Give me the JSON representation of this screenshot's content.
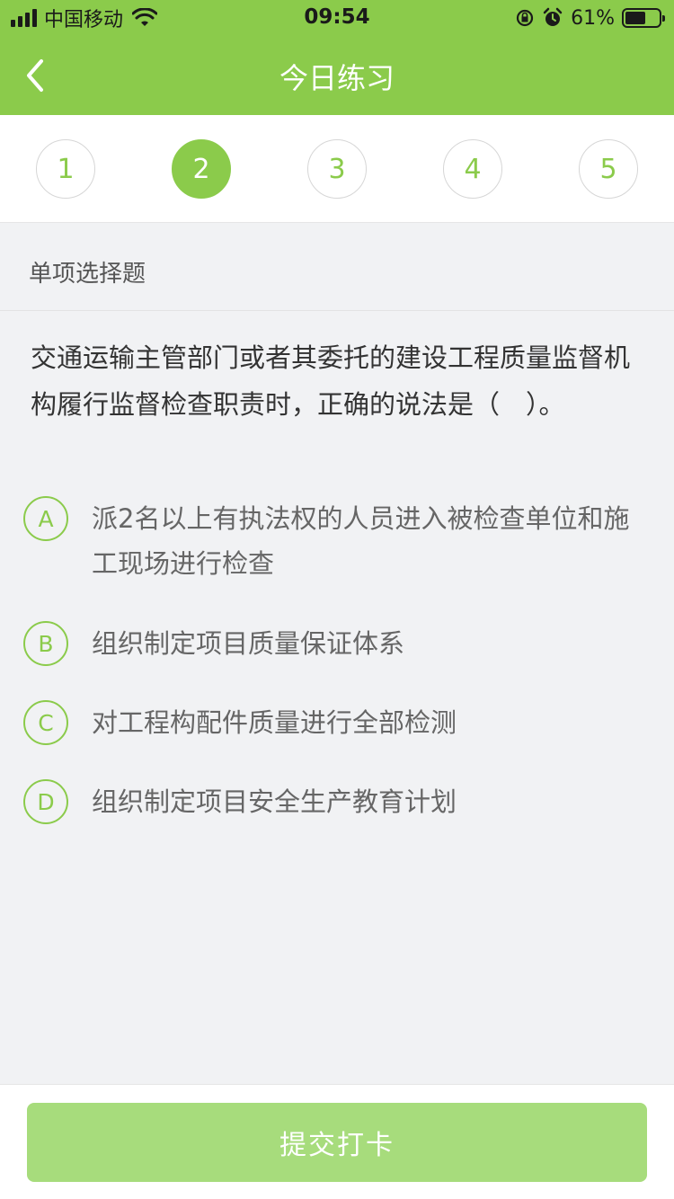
{
  "status_bar": {
    "carrier": "中国移动",
    "time": "09:54",
    "battery_percent": "61%",
    "battery_level": 0.61,
    "icons": [
      "signal-icon",
      "wifi-icon",
      "rotation-lock-icon",
      "alarm-icon",
      "battery-icon"
    ]
  },
  "nav": {
    "title": "今日练习",
    "back_icon": "chevron-left-icon"
  },
  "question_numbers": {
    "items": [
      "1",
      "2",
      "3",
      "4",
      "5"
    ],
    "active": "2"
  },
  "question": {
    "type": "单项选择题",
    "stem_line1": "交通运输主管部门或者其委托的建设工程质量监督机",
    "stem_line2": "构履行监督检查职责时，正确的说法是（　）。",
    "options": [
      {
        "letter": "A",
        "line1": "派2名以上有执法权的人员进入被检查单位和施",
        "line2": "工现场进行检查"
      },
      {
        "letter": "B",
        "line1": "组织制定项目质量保证体系"
      },
      {
        "letter": "C",
        "line1": "对工程构配件质量进行全部检测"
      },
      {
        "letter": "D",
        "line1": "组织制定项目安全生产教育计划"
      }
    ]
  },
  "footer": {
    "submit_label": "提交打卡"
  },
  "colors": {
    "brand": "#8bcb4b",
    "button_disabled": "#a7dc7c",
    "background": "#f1f2f4"
  }
}
